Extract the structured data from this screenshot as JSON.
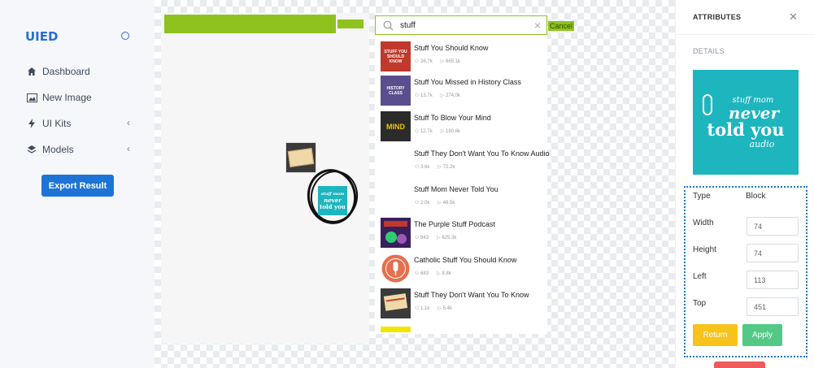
{
  "app": {
    "brand": "UIED"
  },
  "sidebar": {
    "items": [
      {
        "label": "Dashboard",
        "icon": "home-icon",
        "has_chevron": false
      },
      {
        "label": "New Image",
        "icon": "image-icon",
        "has_chevron": false
      },
      {
        "label": "UI Kits",
        "icon": "bolt-icon",
        "has_chevron": true
      },
      {
        "label": "Models",
        "icon": "layers-icon",
        "has_chevron": true
      }
    ],
    "export_label": "Export Result"
  },
  "search": {
    "value": "stuff",
    "cancel_label": "Cancel"
  },
  "results": [
    {
      "title": "Stuff You Should Know",
      "subs": "26.7k",
      "plays": "665.1k",
      "art_color": "#c0392b",
      "art_text": "STUFF YOU SHOULD KNOW"
    },
    {
      "title": "Stuff You Missed in History Class",
      "subs": "13.7k",
      "plays": "274.0k",
      "art_color": "#5b4e8c",
      "art_text": "HISTORY CLASS"
    },
    {
      "title": "Stuff To Blow Your Mind",
      "subs": "12.7k",
      "plays": "190.6k",
      "art_color": "#2b2b2b",
      "art_text": "MIND"
    },
    {
      "title": "Stuff They Don't Want You To Know Audio",
      "subs": "3.6k",
      "plays": "72.2k",
      "art_color": "#ffffff",
      "art_text": ""
    },
    {
      "title": "Stuff Mom Never Told You",
      "subs": "2.0k",
      "plays": "48.5k",
      "art_color": "#ffffff",
      "art_text": ""
    },
    {
      "title": "The Purple Stuff Podcast",
      "subs": "943",
      "plays": "625.3k",
      "art_color": "#3b1e5c",
      "art_text": ""
    },
    {
      "title": "Catholic Stuff You Should Know",
      "subs": "683",
      "plays": "8.8k",
      "art_color": "#e4704e",
      "art_text": ""
    },
    {
      "title": "Stuff They Don't Want You To Know",
      "subs": "1.1k",
      "plays": "5.4k",
      "art_color": "#3a3a3a",
      "art_text": ""
    }
  ],
  "attributes": {
    "title": "ATTRIBUTES",
    "details_label": "DETAILS",
    "preview": {
      "line1": "stuff mom",
      "line2": "never",
      "line3": "told you",
      "line4": "audio"
    },
    "type_label": "Type",
    "type_value": "Block",
    "width_label": "Width",
    "width_value": "74",
    "height_label": "Height",
    "height_value": "74",
    "left_label": "Left",
    "left_value": "113",
    "top_label": "Top",
    "top_value": "451",
    "return_label": "Return",
    "apply_label": "Apply"
  },
  "canvas_preview": {
    "line1": "stuff mom",
    "line2": "never",
    "line3": "told you"
  },
  "colors": {
    "accent": "#1e74d6",
    "green": "#8dc21f",
    "teal": "#1db5be",
    "return": "#f7c31b",
    "apply": "#52c985"
  }
}
